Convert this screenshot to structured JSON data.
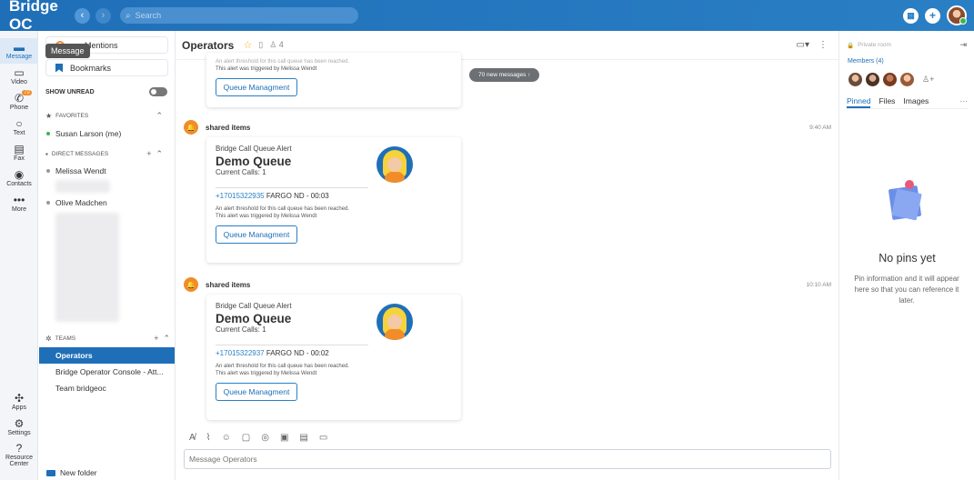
{
  "app": {
    "title": "Bridge OC"
  },
  "search": {
    "placeholder": "Search"
  },
  "rail": {
    "tooltip": "Message",
    "items": [
      {
        "label": "Message",
        "icon": "message-icon",
        "active": true
      },
      {
        "label": "Video",
        "icon": "video-icon"
      },
      {
        "label": "Phone",
        "icon": "phone-icon",
        "badge": "72"
      },
      {
        "label": "Text",
        "icon": "text-icon"
      },
      {
        "label": "Fax",
        "icon": "fax-icon"
      },
      {
        "label": "Contacts",
        "icon": "contacts-icon"
      },
      {
        "label": "More",
        "icon": "more-icon"
      }
    ],
    "bottom": [
      {
        "label": "Apps",
        "icon": "apps-icon"
      },
      {
        "label": "Settings",
        "icon": "settings-icon"
      },
      {
        "label": "Resource",
        "label2": "Center",
        "icon": "help-icon"
      }
    ]
  },
  "sidebar": {
    "mentions_label": "Mentions",
    "bookmarks_label": "Bookmarks",
    "show_unread_label": "SHOW UNREAD",
    "favorites_label": "FAVORITES",
    "favorites": [
      "Susan Larson (me)"
    ],
    "direct_label": "DIRECT MESSAGES",
    "direct": [
      "Melissa Wendt",
      "Olive Madchen"
    ],
    "teams_label": "TEAMS",
    "teams": [
      "Operators",
      "Bridge Operator Console - Att...",
      "Team bridgeoc"
    ],
    "new_folder_label": "New folder"
  },
  "chat": {
    "title": "Operators",
    "member_count": "4",
    "new_messages": "70 new messages",
    "top_card": {
      "note1": "An alert threshold for this call queue has been reached.",
      "note2": "This alert was triggered by Melissa Wendt",
      "button": "Queue Managment"
    },
    "messages": [
      {
        "author": "shared items",
        "time": "9:40 AM",
        "card_sub": "Bridge Call Queue Alert",
        "card_title": "Demo Queue",
        "calls": "Current Calls: 1",
        "phone": "+17015322935",
        "phone_rest": " FARGO ND - 00:03",
        "note1": "An alert threshold for this call queue has been reached.",
        "note2": "This alert was triggered by Melissa Wendt",
        "button": "Queue Managment"
      },
      {
        "author": "shared items",
        "time": "10:10 AM",
        "card_sub": "Bridge Call Queue Alert",
        "card_title": "Demo Queue",
        "calls": "Current Calls: 1",
        "phone": "+17015322937",
        "phone_rest": " FARGO ND - 00:02",
        "note1": "An alert threshold for this call queue has been reached.",
        "note2": "This alert was triggered by Melissa Wendt",
        "button": "Queue Managment"
      }
    ],
    "composer_placeholder": "Message Operators"
  },
  "rpanel": {
    "private_label": "Private room",
    "members_label": "Members (4)",
    "tabs": [
      "Pinned",
      "Files",
      "Images"
    ],
    "tabs_more": "···",
    "empty_title": "No pins yet",
    "empty_desc": "Pin information and it will appear here so that you can reference it later."
  },
  "colors": {
    "brand": "#1f6fb8",
    "accent": "#f28c28",
    "online": "#3bb54a"
  }
}
